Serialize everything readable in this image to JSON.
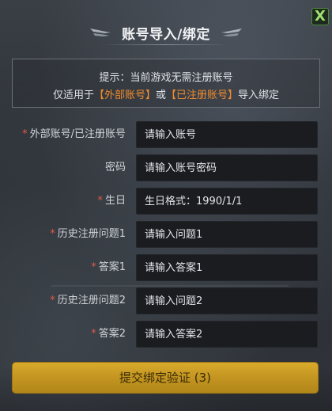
{
  "dialog": {
    "title": "账号导入/绑定",
    "close_glyph": "X"
  },
  "notice": {
    "line1": "提示：当前游戏无需注册账号",
    "line2_prefix": "仅适用于",
    "line2_highlight1": "【外部账号】",
    "line2_mid": "或",
    "line2_highlight2": "【已注册账号】",
    "line2_suffix": "导入绑定"
  },
  "form": {
    "fields": [
      {
        "required": true,
        "required_mark": "*",
        "label": "外部账号/已注册账号",
        "placeholder": "请输入账号"
      },
      {
        "required": false,
        "required_mark": "",
        "label": "密码",
        "placeholder": "请输入账号密码"
      },
      {
        "required": true,
        "required_mark": "*",
        "label": "生日",
        "placeholder": "生日格式：1990/1/1"
      },
      {
        "required": true,
        "required_mark": "*",
        "label": "历史注册问题1",
        "placeholder": "请输入问题1"
      },
      {
        "required": true,
        "required_mark": "*",
        "label": "答案1",
        "placeholder": "请输入答案1"
      },
      {
        "required": true,
        "required_mark": "*",
        "label": "历史注册问题2",
        "placeholder": "请输入问题2"
      },
      {
        "required": true,
        "required_mark": "*",
        "label": "答案2",
        "placeholder": "请输入答案2"
      }
    ]
  },
  "submit": {
    "label": "提交绑定验证 (3)"
  },
  "colors": {
    "accent_gold": "#c89c24",
    "highlight_orange": "#f08b2c",
    "required_red": "#e05a48",
    "close_green": "#9fe46f"
  },
  "icons": {
    "close": "close-icon",
    "title_left": "wing-left-icon",
    "title_right": "wing-right-icon"
  }
}
